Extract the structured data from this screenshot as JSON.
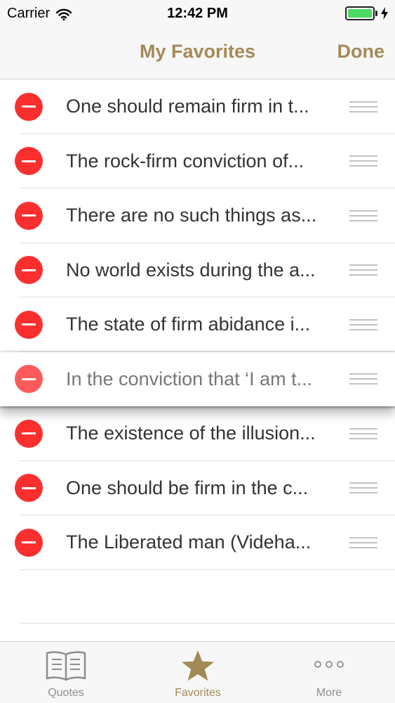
{
  "status_bar": {
    "carrier": "Carrier",
    "time": "12:42 PM"
  },
  "nav": {
    "title": "My Favorites",
    "done_label": "Done"
  },
  "favorites": [
    {
      "text": "One should remain firm in t..."
    },
    {
      "text": "The rock-firm conviction of..."
    },
    {
      "text": "There are no such things as..."
    },
    {
      "text": "No world exists during the a..."
    },
    {
      "text": "The state of firm abidance i..."
    },
    {
      "text": "In the conviction that ‘I am t..."
    },
    {
      "text": "The existence of the illusion..."
    },
    {
      "text": "One should be firm in the c..."
    },
    {
      "text": "The Liberated man (Videha..."
    }
  ],
  "tabs": [
    {
      "label": "Quotes",
      "icon": "book-icon"
    },
    {
      "label": "Favorites",
      "icon": "star-icon"
    },
    {
      "label": "More",
      "icon": "more-dots-icon"
    }
  ],
  "colors": {
    "accent": "#a38a55",
    "delete": "#fc2f2f",
    "battery": "#4cd964"
  }
}
